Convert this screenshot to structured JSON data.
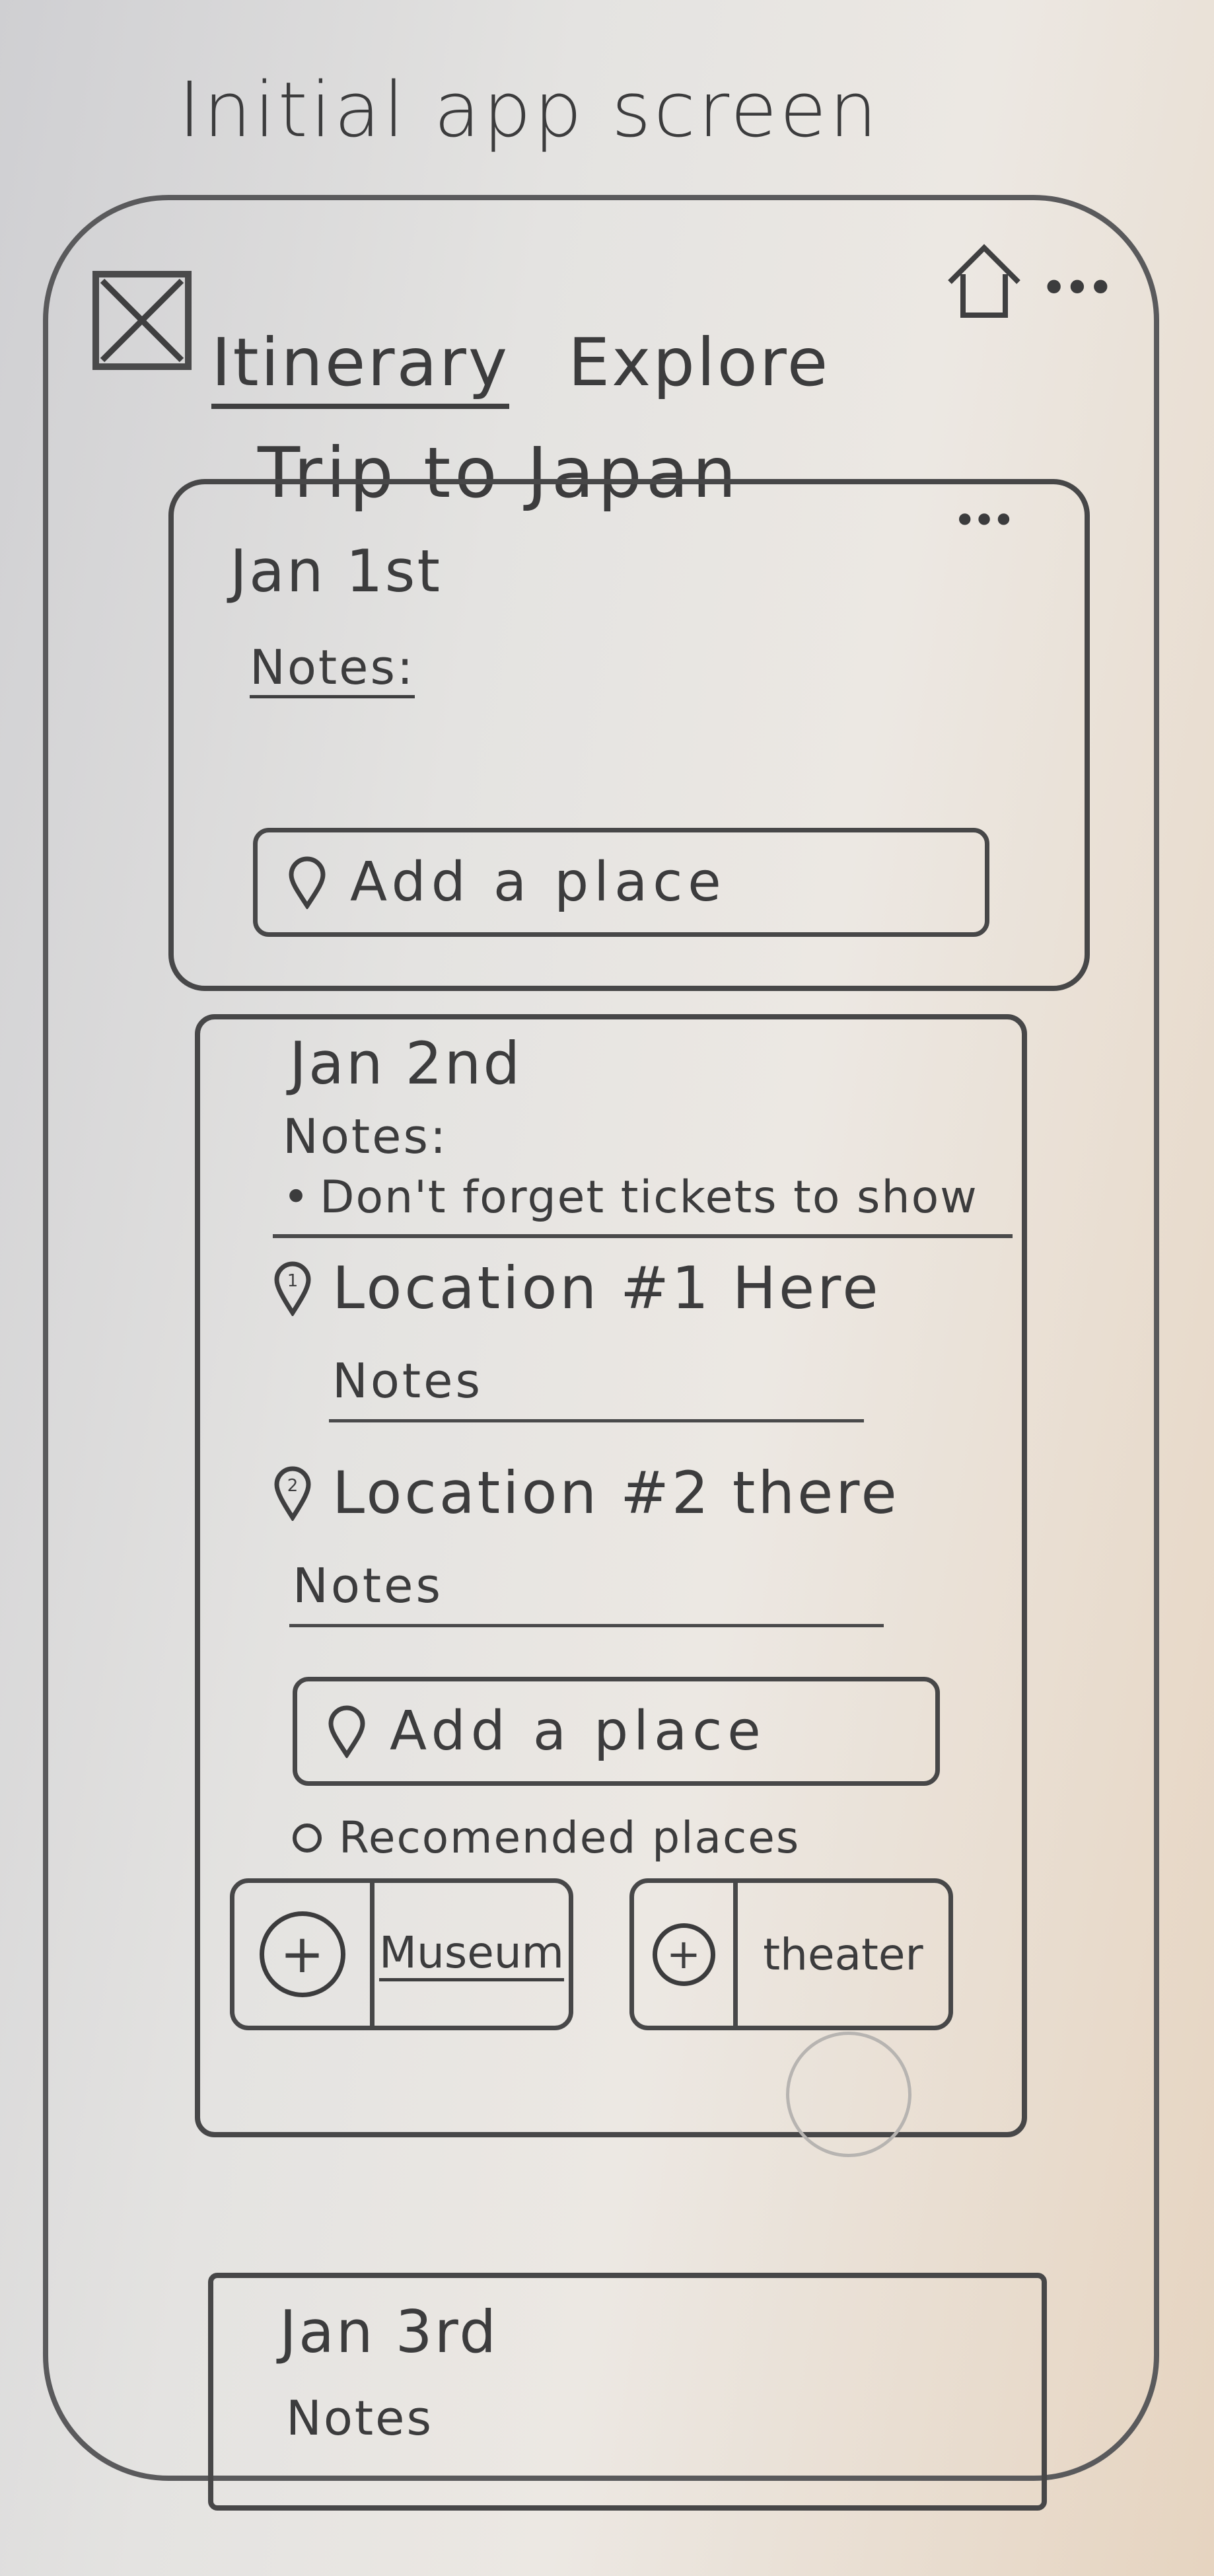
{
  "sheet_title": "Initial app screen",
  "header": {
    "tabs": [
      {
        "label": "Itinerary",
        "active": true
      },
      {
        "label": "Explore",
        "active": false
      }
    ],
    "more_label": "•••",
    "trip_title": "Trip to Japan"
  },
  "days": [
    {
      "date": "Jan 1st",
      "notes_label": "Notes:",
      "more_label": "•••",
      "add_place_label": "Add a place"
    },
    {
      "date": "Jan 2nd",
      "notes_label": "Notes:",
      "note_bullet": "Don't forget tickets to show",
      "locations": [
        {
          "number": "1",
          "name": "Location #1 Here",
          "notes_label": "Notes"
        },
        {
          "number": "2",
          "name": "Location #2 there",
          "notes_label": "Notes"
        }
      ],
      "add_place_label": "Add a place",
      "recommended_label": "Recomended places",
      "recommended": [
        {
          "name": "Museum"
        },
        {
          "name": "theater"
        }
      ]
    },
    {
      "date": "Jan 3rd",
      "notes_label": "Notes"
    }
  ],
  "colors": {
    "ink": "#3f3f40",
    "paper": "#e8e6e3"
  }
}
